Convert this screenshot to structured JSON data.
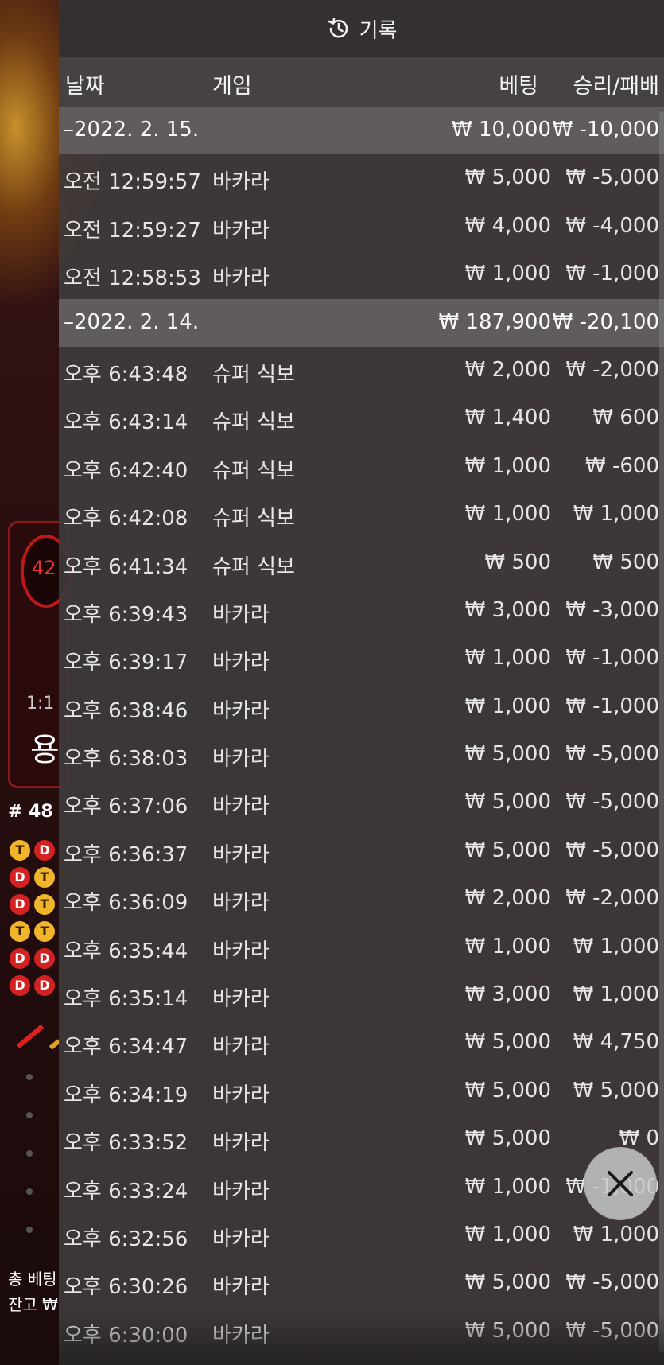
{
  "panel": {
    "title": "기록",
    "icon": "history-icon",
    "columns": {
      "date": "날짜",
      "game": "게임",
      "bet": "베팅",
      "winloss": "승리/패배"
    },
    "rows": [
      {
        "type": "date",
        "time": "–2022. 2. 15.",
        "game": "",
        "bet": "₩ 10,000",
        "winloss": "₩ -10,000"
      },
      {
        "type": "entry",
        "time": "오전 12:59:57",
        "game": "바카라",
        "bet": "₩ 5,000",
        "winloss": "₩ -5,000"
      },
      {
        "type": "entry",
        "time": "오전 12:59:27",
        "game": "바카라",
        "bet": "₩ 4,000",
        "winloss": "₩ -4,000"
      },
      {
        "type": "entry",
        "time": "오전 12:58:53",
        "game": "바카라",
        "bet": "₩ 1,000",
        "winloss": "₩ -1,000"
      },
      {
        "type": "date",
        "time": "–2022. 2. 14.",
        "game": "",
        "bet": "₩ 187,900",
        "winloss": "₩ -20,100"
      },
      {
        "type": "entry",
        "time": "오후 6:43:48",
        "game": "슈퍼 식보",
        "bet": "₩ 2,000",
        "winloss": "₩ -2,000"
      },
      {
        "type": "entry",
        "time": "오후 6:43:14",
        "game": "슈퍼 식보",
        "bet": "₩ 1,400",
        "winloss": "₩ 600"
      },
      {
        "type": "entry",
        "time": "오후 6:42:40",
        "game": "슈퍼 식보",
        "bet": "₩ 1,000",
        "winloss": "₩ -600"
      },
      {
        "type": "entry",
        "time": "오후 6:42:08",
        "game": "슈퍼 식보",
        "bet": "₩ 1,000",
        "winloss": "₩ 1,000"
      },
      {
        "type": "entry",
        "time": "오후 6:41:34",
        "game": "슈퍼 식보",
        "bet": "₩ 500",
        "winloss": "₩ 500"
      },
      {
        "type": "entry",
        "time": "오후 6:39:43",
        "game": "바카라",
        "bet": "₩ 3,000",
        "winloss": "₩ -3,000"
      },
      {
        "type": "entry",
        "time": "오후 6:39:17",
        "game": "바카라",
        "bet": "₩ 1,000",
        "winloss": "₩ -1,000"
      },
      {
        "type": "entry",
        "time": "오후 6:38:46",
        "game": "바카라",
        "bet": "₩ 1,000",
        "winloss": "₩ -1,000"
      },
      {
        "type": "entry",
        "time": "오후 6:38:03",
        "game": "바카라",
        "bet": "₩ 5,000",
        "winloss": "₩ -5,000"
      },
      {
        "type": "entry",
        "time": "오후 6:37:06",
        "game": "바카라",
        "bet": "₩ 5,000",
        "winloss": "₩ -5,000"
      },
      {
        "type": "entry",
        "time": "오후 6:36:37",
        "game": "바카라",
        "bet": "₩ 5,000",
        "winloss": "₩ -5,000"
      },
      {
        "type": "entry",
        "time": "오후 6:36:09",
        "game": "바카라",
        "bet": "₩ 2,000",
        "winloss": "₩ -2,000"
      },
      {
        "type": "entry",
        "time": "오후 6:35:44",
        "game": "바카라",
        "bet": "₩ 1,000",
        "winloss": "₩ 1,000"
      },
      {
        "type": "entry",
        "time": "오후 6:35:14",
        "game": "바카라",
        "bet": "₩ 3,000",
        "winloss": "₩ 1,000"
      },
      {
        "type": "entry",
        "time": "오후 6:34:47",
        "game": "바카라",
        "bet": "₩ 5,000",
        "winloss": "₩ 4,750"
      },
      {
        "type": "entry",
        "time": "오후 6:34:19",
        "game": "바카라",
        "bet": "₩ 5,000",
        "winloss": "₩ 5,000"
      },
      {
        "type": "entry",
        "time": "오후 6:33:52",
        "game": "바카라",
        "bet": "₩ 5,000",
        "winloss": "₩ 0"
      },
      {
        "type": "entry",
        "time": "오후 6:33:24",
        "game": "바카라",
        "bet": "₩ 1,000",
        "winloss": "₩ -1,000"
      },
      {
        "type": "entry",
        "time": "오후 6:32:56",
        "game": "바카라",
        "bet": "₩ 1,000",
        "winloss": "₩ 1,000"
      },
      {
        "type": "entry",
        "time": "오후 6:30:26",
        "game": "바카라",
        "bet": "₩ 5,000",
        "winloss": "₩ -5,000"
      },
      {
        "type": "entry",
        "time": "오후 6:30:00",
        "game": "바카라",
        "bet": "₩ 5,000",
        "winloss": "₩ -5,000"
      }
    ],
    "close_icon": "close-icon"
  },
  "background": {
    "circle_number": "42",
    "ratio": "1:1",
    "dragon_label": "용",
    "round_label": "# 48",
    "beads": [
      "T",
      "D",
      "D",
      "T",
      "D",
      "T",
      "T",
      "T",
      "D",
      "D",
      "D",
      "D"
    ],
    "total_bet_label": "총 베팅",
    "balance_label": "잔고 ₩"
  },
  "colors": {
    "bead_tie": "#f0b52a",
    "bead_dragon": "#d42222",
    "panel": "#3e3a3a"
  }
}
